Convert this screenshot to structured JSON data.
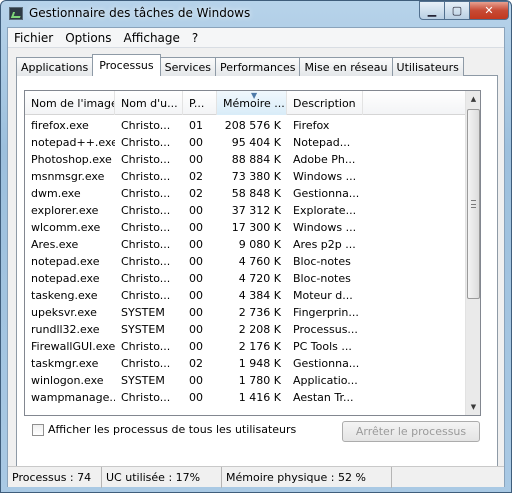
{
  "window": {
    "title": "Gestionnaire des tâches de Windows",
    "min_label": "▁",
    "max_label": "▢",
    "close_label": "✕"
  },
  "menu": [
    "Fichier",
    "Options",
    "Affichage",
    "?"
  ],
  "tabs": [
    "Applications",
    "Processus",
    "Services",
    "Performances",
    "Mise en réseau",
    "Utilisateurs"
  ],
  "active_tab": "Processus",
  "columns": [
    "Nom de l'image",
    "Nom d'u...",
    "P...",
    "Mémoire ...",
    "Description"
  ],
  "rows": [
    [
      "firefox.exe",
      "Christo...",
      "01",
      "208 576 K",
      "Firefox"
    ],
    [
      "notepad++.exe",
      "Christo...",
      "00",
      "95 404 K",
      "Notepad..."
    ],
    [
      "Photoshop.exe",
      "Christo...",
      "00",
      "88 884 K",
      "Adobe Ph..."
    ],
    [
      "msnmsgr.exe",
      "Christo...",
      "02",
      "73 380 K",
      "Windows ..."
    ],
    [
      "dwm.exe",
      "Christo...",
      "02",
      "58 848 K",
      "Gestionna..."
    ],
    [
      "explorer.exe",
      "Christo...",
      "00",
      "37 312 K",
      "Explorate..."
    ],
    [
      "wlcomm.exe",
      "Christo...",
      "00",
      "17 300 K",
      "Windows ..."
    ],
    [
      "Ares.exe",
      "Christo...",
      "00",
      "9 080 K",
      "Ares p2p ..."
    ],
    [
      "notepad.exe",
      "Christo...",
      "00",
      "4 760 K",
      "Bloc-notes"
    ],
    [
      "notepad.exe",
      "Christo...",
      "00",
      "4 720 K",
      "Bloc-notes"
    ],
    [
      "taskeng.exe",
      "Christo...",
      "00",
      "4 384 K",
      "Moteur d..."
    ],
    [
      "upeksvr.exe",
      "SYSTEM",
      "00",
      "2 736 K",
      "Fingerprin..."
    ],
    [
      "rundll32.exe",
      "SYSTEM",
      "00",
      "2 208 K",
      "Processus..."
    ],
    [
      "FirewallGUI.exe",
      "Christo...",
      "00",
      "2 176 K",
      "PC Tools ..."
    ],
    [
      "taskmgr.exe",
      "Christo...",
      "02",
      "1 948 K",
      "Gestionna..."
    ],
    [
      "winlogon.exe",
      "SYSTEM",
      "00",
      "1 780 K",
      "Applicatio..."
    ],
    [
      "wampmanage...",
      "Christo...",
      "00",
      "1 416 K",
      "Aestan Tr..."
    ]
  ],
  "show_all_label": "Afficher les processus de tous les utilisateurs",
  "end_process_label": "Arrêter le processus",
  "status": {
    "processes": "Processus : 74",
    "cpu": "UC utilisée : 17%",
    "memory": "Mémoire physique : 52 %"
  },
  "icons": {
    "app": "task-manager-icon",
    "sort": "sort-down-icon",
    "scroll_up": "▲",
    "scroll_down": "▼"
  }
}
